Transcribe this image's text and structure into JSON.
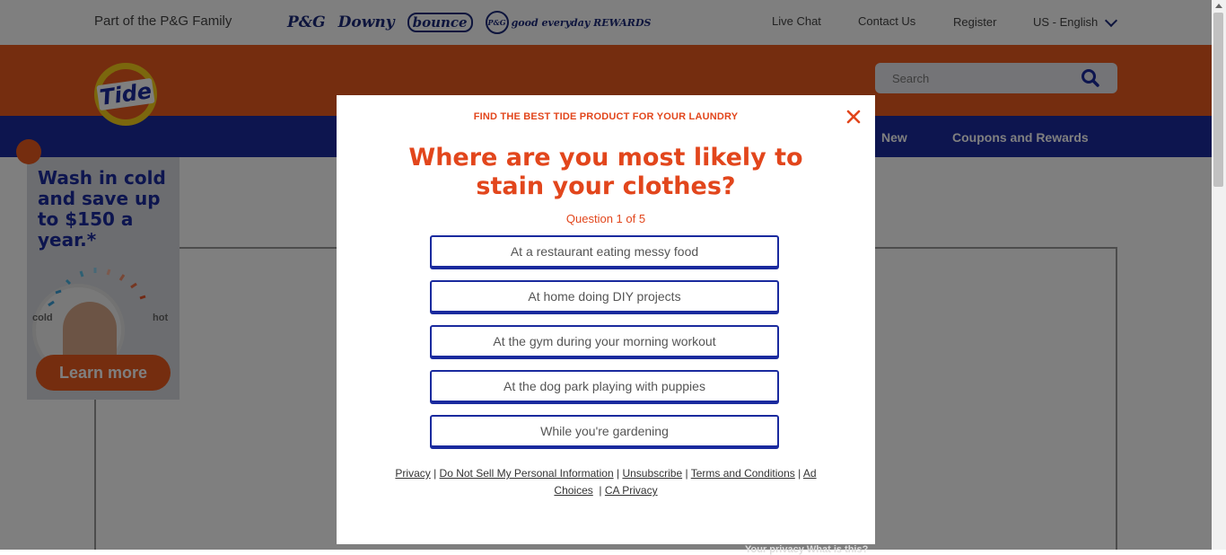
{
  "topbar": {
    "family_text": "Part of the P&G Family",
    "brands": [
      "P&G",
      "Downy",
      "bounce",
      "good everyday REWARDS"
    ],
    "links": {
      "live_chat": "Live Chat",
      "contact_us": "Contact Us",
      "register": "Register",
      "locale": "US - English"
    }
  },
  "header": {
    "logo_text": "Tide",
    "search_placeholder": "Search"
  },
  "nav": {
    "items": [
      "New",
      "Coupons and Rewards"
    ]
  },
  "ad": {
    "headline": "Wash in cold and save up to $150 a year.*",
    "cold_label": "cold",
    "hot_label": "hot",
    "cta": "Learn more"
  },
  "modal": {
    "kicker": "FIND THE BEST TIDE PRODUCT FOR YOUR LAUNDRY",
    "question": "Where are you most likely to stain your clothes?",
    "progress": "Question 1 of 5",
    "answers": [
      "At a restaurant eating messy food",
      "At home doing DIY projects",
      "At the gym during your morning workout",
      "At the dog park playing with puppies",
      "While you're gardening"
    ],
    "footer_links": [
      "Privacy",
      "Do Not Sell My Personal Information",
      "Unsubscribe",
      "Terms and Conditions",
      "Ad Choices",
      "CA Privacy"
    ]
  },
  "bottom_text": "Your privacy  What is this?",
  "colors": {
    "orange": "#ea5a1f",
    "navy": "#1a2a9e",
    "accent_red": "#e2461c"
  }
}
